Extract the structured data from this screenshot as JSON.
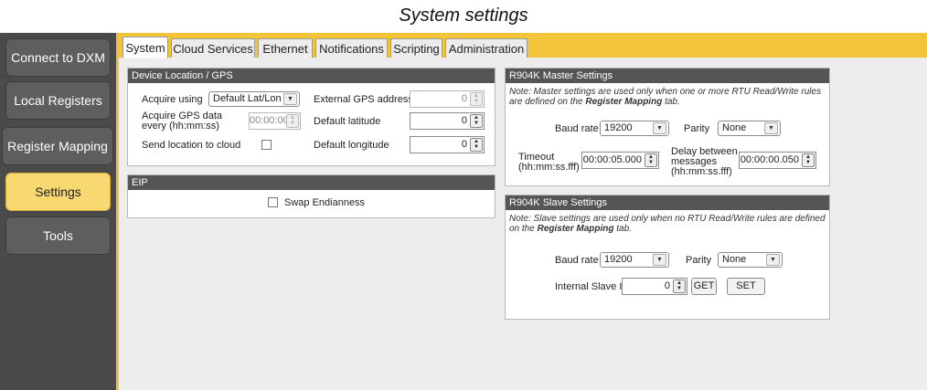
{
  "page_title": "System settings",
  "sidebar": {
    "items": [
      {
        "label": "Connect to DXM"
      },
      {
        "label": "Local Registers"
      },
      {
        "label": "Register Mapping"
      },
      {
        "label": "Settings"
      },
      {
        "label": "Tools"
      }
    ],
    "active": "Settings"
  },
  "tabs": [
    {
      "label": "System"
    },
    {
      "label": "Cloud Services"
    },
    {
      "label": "Ethernet"
    },
    {
      "label": "Notifications"
    },
    {
      "label": "Scripting"
    },
    {
      "label": "Administration"
    }
  ],
  "active_tab": "System",
  "gps": {
    "title": "Device Location / GPS",
    "acquire_using_label": "Acquire using",
    "acquire_using_value": "Default Lat/Lon",
    "acquire_every_label_1": "Acquire GPS data",
    "acquire_every_label_2": "every (hh:mm:ss)",
    "acquire_every_value": "00:00:00",
    "send_location_label": "Send location to cloud",
    "ext_gps_label": "External GPS address",
    "ext_gps_value": "0",
    "default_lat_label": "Default latitude",
    "default_lat_value": "0",
    "default_lon_label": "Default longitude",
    "default_lon_value": "0"
  },
  "eip": {
    "title": "EIP",
    "swap_label": "Swap Endianness"
  },
  "master": {
    "title": "R904K Master Settings",
    "note_1": "Note: Master settings are used only when one or more RTU Read/Write rules",
    "note_2_pre": "are defined on the ",
    "note_2_bold": "Register Mapping",
    "note_2_post": " tab.",
    "baud_label": "Baud rate",
    "baud_value": "19200",
    "parity_label": "Parity",
    "parity_value": "None",
    "timeout_label_1": "Timeout",
    "timeout_label_2": "(hh:mm:ss.fff)",
    "timeout_value": "00:00:05.000",
    "delay_label_1": "Delay between",
    "delay_label_2": "messages",
    "delay_label_3": "(hh:mm:ss.fff)",
    "delay_value": "00:00:00.050"
  },
  "slave": {
    "title": "R904K Slave Settings",
    "note_1": "Note: Slave settings are used only when no RTU Read/Write rules are defined",
    "note_2_pre": "on the ",
    "note_2_bold": "Register Mapping",
    "note_2_post": " tab.",
    "baud_label": "Baud rate",
    "baud_value": "19200",
    "parity_label": "Parity",
    "parity_value": "None",
    "slave_id_label": "Internal Slave ID",
    "slave_id_value": "0",
    "get_label": "GET",
    "set_label": "SET"
  }
}
